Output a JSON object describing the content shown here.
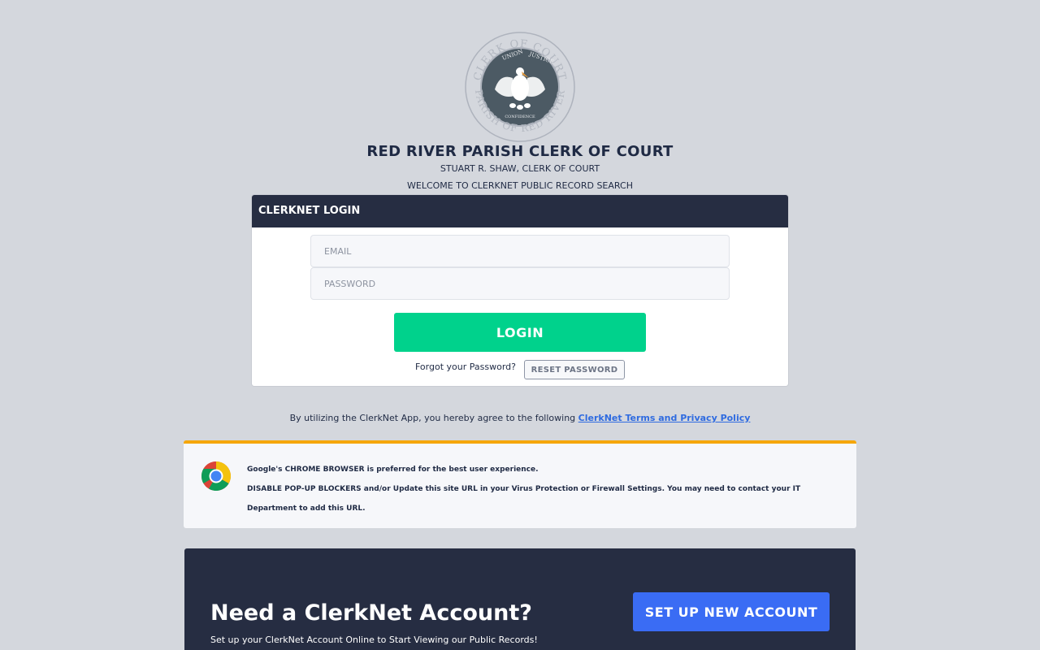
{
  "seal": {
    "outer_text_top": "CLERK OF COURT",
    "outer_text_bottom": "PARISH OF RED RIVER",
    "inner_text_left": "UNION",
    "inner_text_right": "JUSTICE",
    "inner_text_bottom": "CONFIDENCE"
  },
  "header": {
    "title": "RED RIVER PARISH CLERK OF COURT",
    "clerk_name": "STUART R. SHAW, CLERK OF COURT",
    "welcome": "WELCOME TO CLERKNET PUBLIC RECORD SEARCH"
  },
  "login": {
    "heading": "CLERKNET LOGIN",
    "email_placeholder": "EMAIL",
    "email_value": "",
    "password_placeholder": "PASSWORD",
    "password_value": "",
    "login_label": "LOGIN",
    "forgot_text": "Forgot your Password?",
    "reset_label": "RESET PASSWORD"
  },
  "terms": {
    "prefix": "By utilizing the ClerkNet App, you hereby agree to the following",
    "link_text": "ClerkNet Terms and Privacy Policy"
  },
  "notice": {
    "icon": "chrome-icon",
    "line1": "Google's CHROME BROWSER is preferred for the best user experience.",
    "line2": "DISABLE POP-UP BLOCKERS and/or Update this site URL in your Virus Protection or Firewall Settings. You may need to contact your IT Department to add this URL.",
    "accent_color": "#f5a60a"
  },
  "account": {
    "title": "Need a ClerkNet Account?",
    "subtitle": "Set up your ClerkNet Account Online to Start Viewing our Public Records!",
    "setup_label": "SET UP NEW ACCOUNT"
  },
  "colors": {
    "background": "#d4d7dd",
    "header_dark": "#262d42",
    "login_green": "#00d28c",
    "setup_blue": "#3a6cf4",
    "link_blue": "#2f6be0"
  }
}
